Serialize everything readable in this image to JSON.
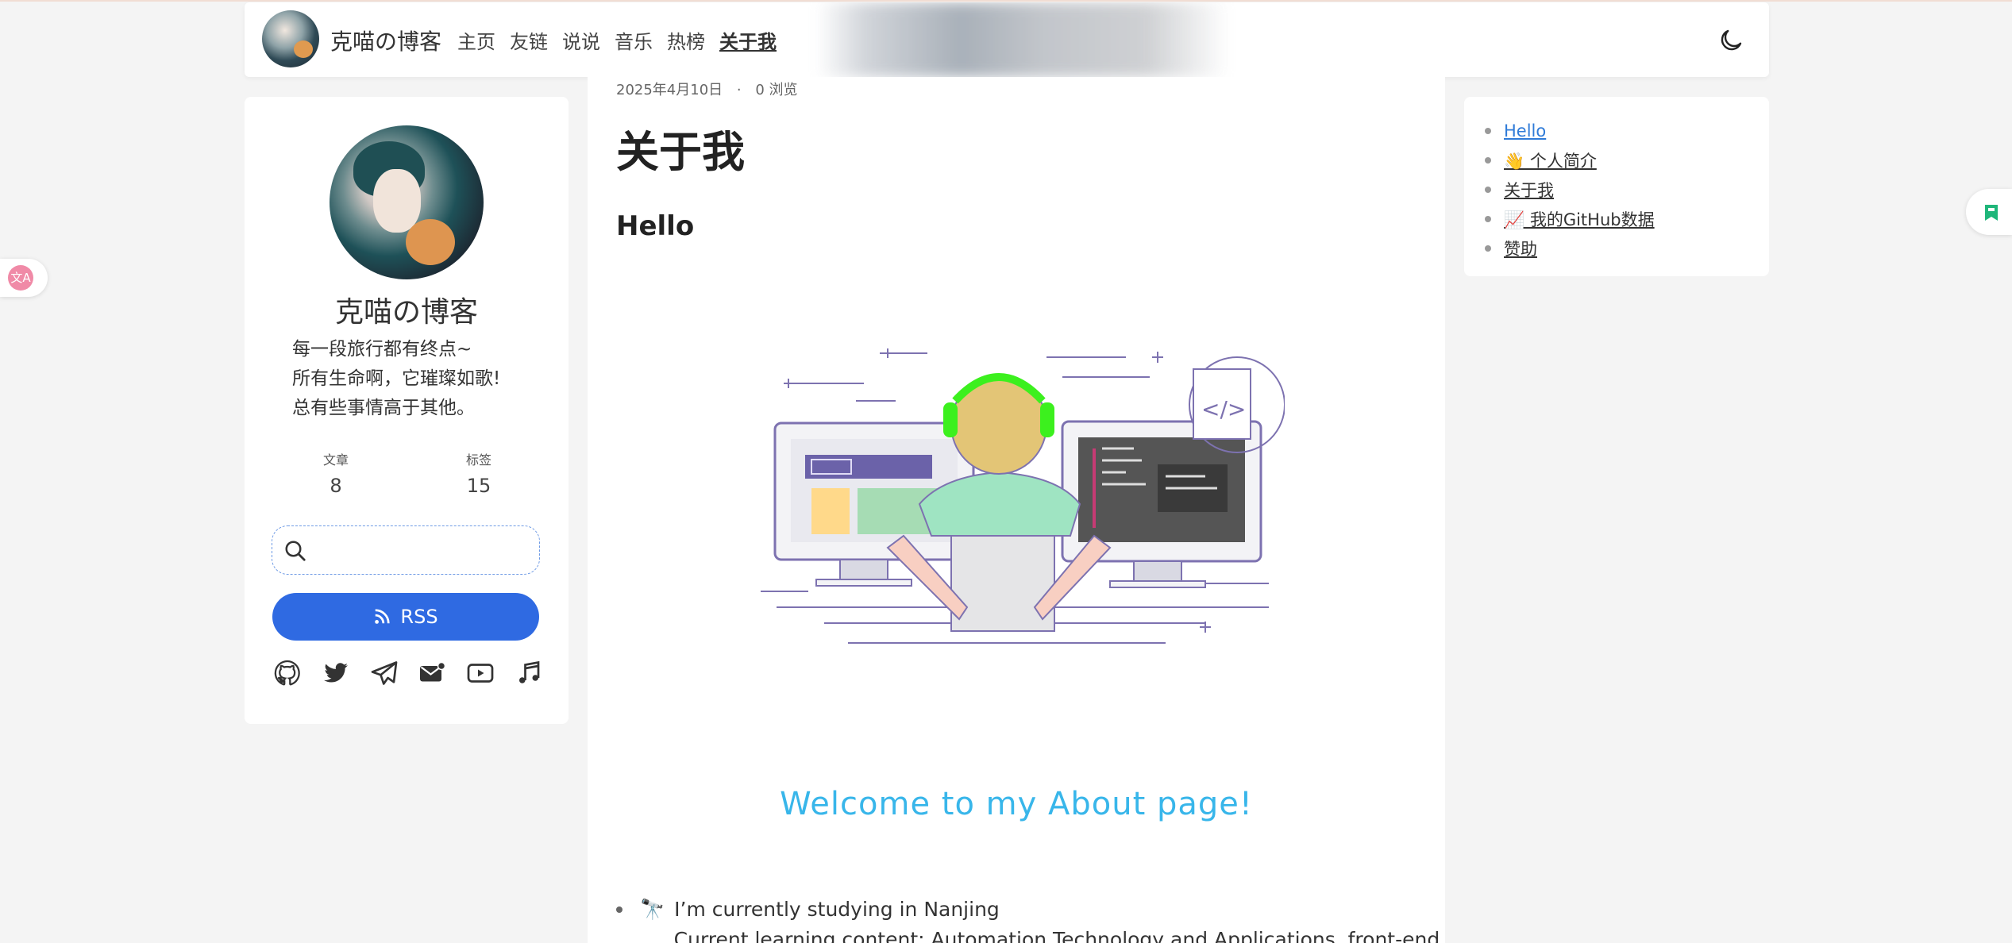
{
  "header": {
    "brand_title": "克喵の博客",
    "nav": [
      "主页",
      "友链",
      "说说",
      "音乐",
      "热榜",
      "关于我"
    ],
    "active_nav": "关于我",
    "theme_icon": "moon-icon"
  },
  "sidebar": {
    "name": "克喵の博客",
    "motto": [
      "每一段旅行都有终点~",
      "所有生命啊，它璀璨如歌!",
      "总有些事情高于其他。"
    ],
    "stats": [
      {
        "label": "文章",
        "value": "8"
      },
      {
        "label": "标签",
        "value": "15"
      }
    ],
    "search": {
      "placeholder": "",
      "value": ""
    },
    "rss_label": "RSS",
    "socials": [
      "github-icon",
      "twitter-icon",
      "telegram-icon",
      "email-icon",
      "youtube-icon",
      "music-icon"
    ]
  },
  "article": {
    "date": "2025年4月10日",
    "separator": "·",
    "views": "0 浏览",
    "title": "关于我",
    "section_heading": "Hello",
    "welcome": "Welcome to my About page!",
    "bullets": [
      {
        "icon": "🔭",
        "text": "I’m currently studying in Nanjing"
      },
      {
        "icon": "🌱",
        "text": "Current learning content: Automation Technology and Applications, front-end (sub)"
      }
    ]
  },
  "toc": {
    "items": [
      "Hello",
      "👋 个人简介",
      "关于我",
      "📈 我的GitHub数据",
      "赞助"
    ],
    "current": "Hello"
  },
  "colors": {
    "accent": "#2f6ae2",
    "welcome": "#38b6ea",
    "toc_current": "#2f7bd8",
    "background": "#f4f4f4"
  }
}
